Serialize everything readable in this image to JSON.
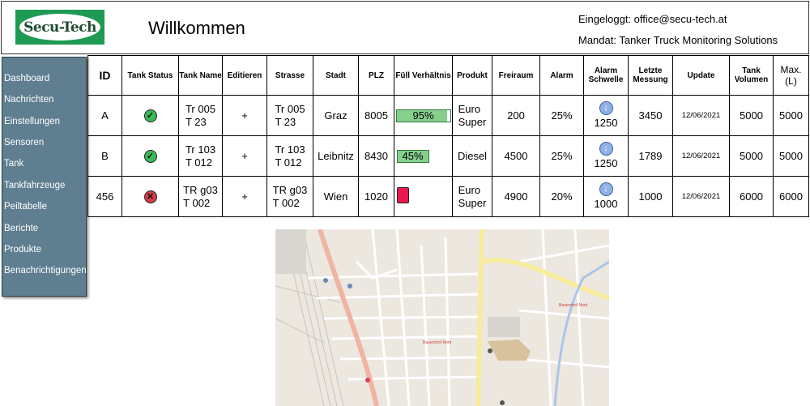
{
  "header": {
    "logo_text": "Secu-Tech",
    "title": "Willkommen",
    "login": "Eingeloggt: office@secu-tech.at",
    "mandat": "Mandat: Tanker Truck Monitoring Solutions"
  },
  "sidebar": {
    "items": [
      {
        "label": "Dashboard"
      },
      {
        "label": "Nachrichten"
      },
      {
        "label": "Einstellungen"
      },
      {
        "label": "Sensoren"
      },
      {
        "label": "Tank"
      },
      {
        "label": "Tankfahrzeuge"
      },
      {
        "label": "Peiltabelle"
      },
      {
        "label": "Berichte"
      },
      {
        "label": "Produkte"
      },
      {
        "label": "Benachrichtigungen"
      }
    ]
  },
  "table": {
    "headers": [
      "ID",
      "Tank Status",
      "Tank Name",
      "Editieren",
      "Strasse",
      "Stadt",
      "PLZ",
      "Füll Verhältnis",
      "Produkt",
      "Freiraum",
      "Alarm",
      "Alarm Schwelle",
      "Letzte Messung",
      "Update",
      "Tank Volumen",
      "Max. (L)"
    ],
    "rows": [
      {
        "id": "A",
        "status": "ok",
        "status_icon": "check-icon",
        "name_1": "Tr 005",
        "name_2": "T 23",
        "edit": "+",
        "street_1": "Tr 005",
        "street_2": "T 23",
        "city": "Graz",
        "plz": "8005",
        "fill_label": "95%",
        "fill_fraction": 0.95,
        "product_1": "Euro",
        "product_2": "Super",
        "freiraum": "200",
        "alarm": "25%",
        "threshold": "1250",
        "last": "3450",
        "update": "12/06/2021",
        "volume": "5000",
        "max": "5000"
      },
      {
        "id": "B",
        "status": "ok",
        "status_icon": "check-icon",
        "name_1": "Tr 103",
        "name_2": "T 012",
        "edit": "+",
        "street_1": "Tr 103",
        "street_2": "T 012",
        "city": "Leibnitz",
        "plz": "8430",
        "fill_label": "45%",
        "fill_fraction": 0.45,
        "product_1": "Diesel",
        "product_2": "",
        "freiraum": "4500",
        "alarm": "25%",
        "threshold": "1250",
        "last": "1789",
        "update": "12/06/2021",
        "volume": "5000",
        "max": "5000"
      },
      {
        "id": "456",
        "status": "error",
        "status_icon": "x-icon",
        "name_1": "TR g03",
        "name_2": "T 002",
        "edit": "+",
        "street_1": "TR g03",
        "street_2": "T 002",
        "city": "Wien",
        "plz": "1020",
        "fill_label": "",
        "fill_fraction": null,
        "product_1": "Euro",
        "product_2": "Super",
        "freiraum": "4900",
        "alarm": "20%",
        "threshold": "1000",
        "last": "1000",
        "update": "12/06/2021",
        "volume": "6000",
        "max": "6000"
      }
    ]
  },
  "map": {
    "labels": [
      "Bauernhof Nord",
      "Bauernhof Nord"
    ]
  },
  "colors": {
    "brand_green": "#1e9a52",
    "sidebar_bg": "#5f7f91",
    "status_ok": "#3cb85a",
    "status_error": "#d43d46",
    "fill_green": "#86cf8d",
    "fill_red": "#e8184f"
  }
}
